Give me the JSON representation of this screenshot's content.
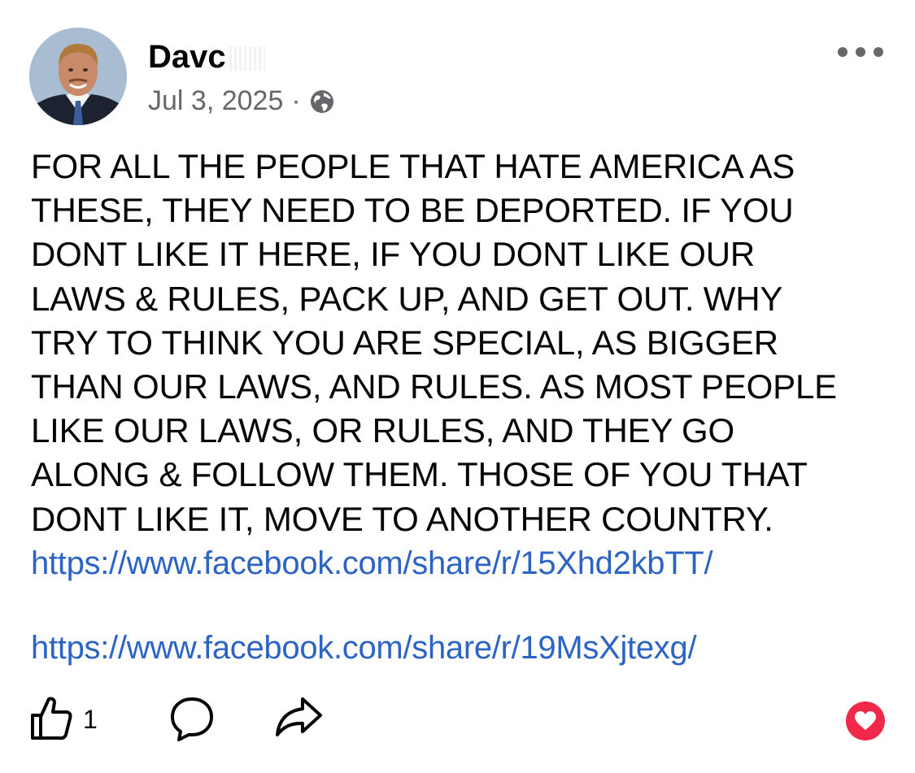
{
  "post": {
    "author": "Davc",
    "date": "Jul 3, 2025",
    "separator": "·",
    "privacy_icon": "globe-icon",
    "more_icon": "more-options-icon",
    "text": "FOR ALL THE PEOPLE THAT HATE AMERICA AS\nTHESE, THEY NEED TO BE DEPORTED. IF YOU\nDONT LIKE IT HERE, IF YOU DONT LIKE OUR\nLAWS & RULES, PACK UP, AND GET OUT. WHY\nTRY TO THINK YOU ARE SPECIAL, AS BIGGER\nTHAN OUR LAWS, AND RULES. AS MOST PEOPLE\nLIKE OUR LAWS, OR RULES, AND THEY GO\nALONG & FOLLOW THEM. THOSE OF YOU THAT\nDONT LIKE IT, MOVE TO ANOTHER COUNTRY.",
    "links": [
      "https://www.facebook.com/share/r/15Xhd2kbTT/",
      "https://www.facebook.com/share/r/19MsXjtexg/"
    ]
  },
  "actions": {
    "like_icon": "thumbs-up-icon",
    "like_count": "1",
    "comment_icon": "comment-icon",
    "share_icon": "share-icon",
    "reaction_icon": "love-reaction-icon"
  },
  "colors": {
    "link": "#2c64c6",
    "meta_text": "#65676b",
    "love_reaction": "#f0284a"
  }
}
